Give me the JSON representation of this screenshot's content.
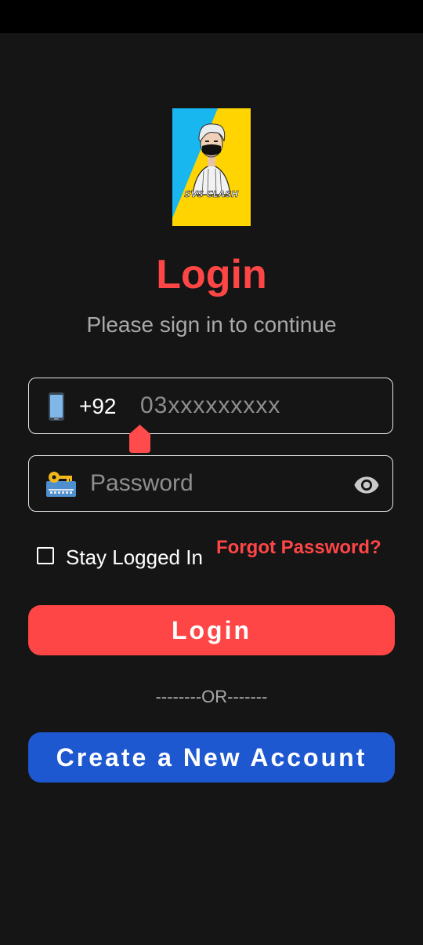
{
  "logo": {
    "text": "SVS CLASH"
  },
  "header": {
    "title": "Login",
    "subtitle": "Please sign in to continue"
  },
  "phone": {
    "country_code": "+92",
    "placeholder": "03xxxxxxxxx",
    "icon": "phone-icon"
  },
  "password": {
    "placeholder": "Password",
    "icon": "key-icon",
    "toggle_icon": "eye-icon"
  },
  "options": {
    "stay_logged_in_label": "Stay Logged In",
    "stay_logged_in_checked": false,
    "forgot_password_label": "Forgot Password?"
  },
  "actions": {
    "login_label": "Login",
    "separator": "--------OR-------",
    "create_account_label": "Create a New Account"
  },
  "colors": {
    "background": "#151515",
    "accent_red": "#ff4646",
    "accent_blue": "#1e58d0",
    "logo_blue": "#18b7ef",
    "logo_yellow": "#ffd400"
  }
}
